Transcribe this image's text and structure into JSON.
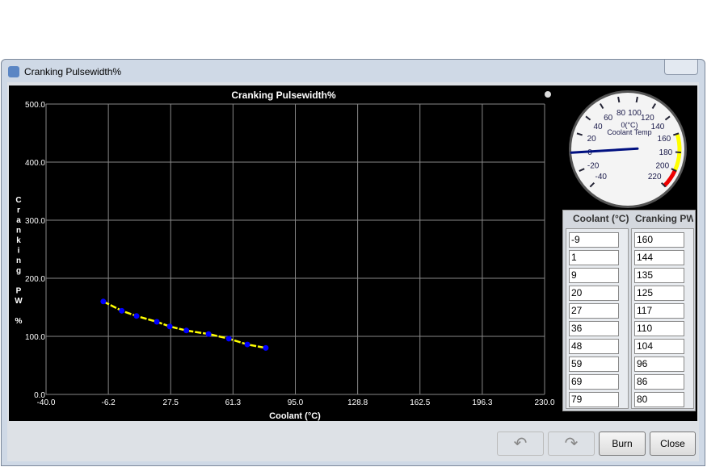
{
  "window": {
    "title": "Cranking Pulsewidth%"
  },
  "chart_data": {
    "type": "line",
    "title": "Cranking Pulsewidth%",
    "xlabel": "Coolant (°C)",
    "ylabel": "Cranking PW %",
    "xlim": [
      -40,
      230
    ],
    "ylim": [
      0,
      500
    ],
    "xticks": [
      "-40.0",
      "-6.2",
      "27.5",
      "61.3",
      "95.0",
      "128.8",
      "162.5",
      "196.3",
      "230.0"
    ],
    "yticks": [
      "0.0",
      "100.0",
      "200.0",
      "300.0",
      "400.0",
      "500.0"
    ],
    "x": [
      -9,
      1,
      9,
      20,
      27,
      36,
      48,
      59,
      69,
      79
    ],
    "y": [
      160,
      144,
      135,
      125,
      117,
      110,
      104,
      96,
      86,
      80
    ],
    "grid": true,
    "line_color": "#ffff00",
    "marker_color": "#0000ff"
  },
  "gauge": {
    "label": "Coolant Temp",
    "readout": "0(°C)",
    "value": 0,
    "min": -40,
    "max": 220,
    "ticks": [
      "-40",
      "-20",
      "0",
      "20",
      "40",
      "60",
      "80",
      "100",
      "120",
      "140",
      "160",
      "180",
      "200",
      "220"
    ]
  },
  "table": {
    "headers": [
      "Coolant (°C)",
      "Cranking PW"
    ],
    "coolant": [
      "-9",
      "1",
      "9",
      "20",
      "27",
      "36",
      "48",
      "59",
      "69",
      "79"
    ],
    "pw": [
      "160",
      "144",
      "135",
      "125",
      "117",
      "110",
      "104",
      "96",
      "86",
      "80"
    ]
  },
  "buttons": {
    "undo": "undo-icon",
    "redo": "redo-icon",
    "burn": "Burn",
    "close": "Close"
  }
}
